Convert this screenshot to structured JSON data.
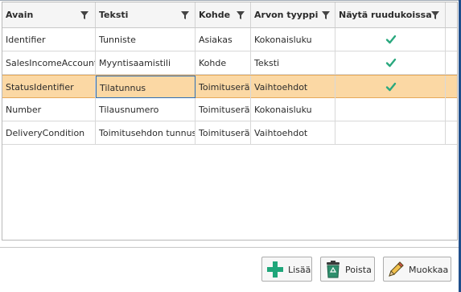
{
  "grid": {
    "columns": [
      {
        "label": "Avain"
      },
      {
        "label": "Teksti"
      },
      {
        "label": "Kohde"
      },
      {
        "label": "Arvon tyyppi"
      },
      {
        "label": "Näytä ruudukoissa"
      }
    ],
    "rows": [
      {
        "avain": "Identifier",
        "teksti": "Tunniste",
        "kohde": "Asiakas",
        "tyyppi": "Kokonaisluku",
        "nayta": true
      },
      {
        "avain": "SalesIncomeAccount",
        "teksti": "Myyntisaamistili",
        "kohde": "Kohde",
        "tyyppi": "Teksti",
        "nayta": true
      },
      {
        "avain": "StatusIdentifier",
        "teksti": "Tilatunnus",
        "kohde": "Toimituserä",
        "tyyppi": "Vaihtoehdot",
        "nayta": true
      },
      {
        "avain": "Number",
        "teksti": "Tilausnumero",
        "kohde": "Toimituserä",
        "tyyppi": "Kokonaisluku",
        "nayta": false
      },
      {
        "avain": "DeliveryCondition",
        "teksti": "Toimitusehdon tunnus",
        "kohde": "Toimituserä",
        "tyyppi": "Vaihtoehdot",
        "nayta": false
      }
    ],
    "selected_row": 2
  },
  "buttons": {
    "add_label": "Lisää",
    "delete_label": "Poista",
    "edit_label": "Muokkaa"
  },
  "icons": {
    "filter": "filter-funnel-icon",
    "check": "check-icon",
    "add": "plus-icon",
    "delete": "recycle-bin-icon",
    "edit": "pencil-icon"
  },
  "colors": {
    "selected_row": "#fbd8a4",
    "check": "#2aa87e",
    "focus_border": "#2c6db5",
    "add_icon": "#1fa67a"
  }
}
